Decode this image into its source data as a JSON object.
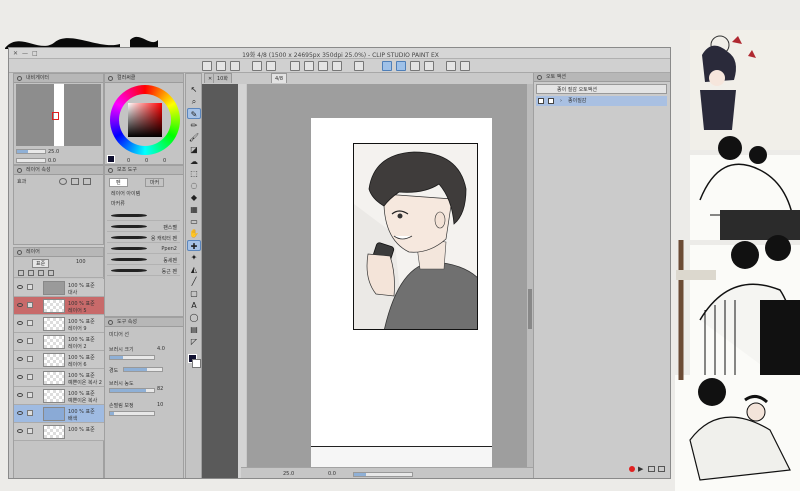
{
  "window": {
    "title": "19화 4/8 (1500 x 24695px 350dpi 25.0%) - CLIP STUDIO PAINT EX",
    "close_glyph": "✕",
    "minimize_glyph": "—",
    "maximize_glyph": "□"
  },
  "panels": {
    "navigator": {
      "title": "내비게이터",
      "zoom": "25.0",
      "angle": "0.0"
    },
    "color_wheel": {
      "title": "컬러써클",
      "h": "0",
      "s": "0",
      "v": "0"
    },
    "layer_property": {
      "title": "레이어 속성",
      "effect_label": "효과"
    },
    "sub_tool": {
      "title": "보조 도구",
      "tabs": [
        "펜",
        "마커"
      ],
      "first_item": "레이어 아이템",
      "group_label": "마커류",
      "brushes": [
        {
          "label": ""
        },
        {
          "label": "팬스펠"
        },
        {
          "label": "용 캐릭터 펜"
        },
        {
          "label": "Ppen2"
        },
        {
          "label": "동세펜"
        },
        {
          "label": "동근 펜"
        }
      ]
    },
    "tool_property": {
      "title": "도구 속성",
      "tool_name": "미디어 선",
      "brush_size_label": "브러시 크기",
      "brush_size": "4.0",
      "hardness_label": "경도",
      "density_label": "브러시 농도",
      "density": "82",
      "stabilization_label": "손떨림 보정",
      "stabilization": "10"
    },
    "layer": {
      "title": "레이어",
      "blend_mode": "표준",
      "opacity": "100",
      "rows": [
        {
          "line1": "100 % 표준",
          "line2": "대사",
          "selected": false
        },
        {
          "line1": "100 % 표준",
          "line2": "레이어 5",
          "selected": false
        },
        {
          "line1": "100 % 표준",
          "line2": "레이어 9",
          "selected": false
        },
        {
          "line1": "100 % 표준",
          "line2": "레이어 2",
          "selected": false
        },
        {
          "line1": "100 % 표준",
          "line2": "레이어 6",
          "selected": false
        },
        {
          "line1": "100 % 표준",
          "line2": "예쁜이온 복사 2",
          "selected": false
        },
        {
          "line1": "100 % 표준",
          "line2": "예쁜이온 복사",
          "selected": false
        },
        {
          "line1": "100 % 표준",
          "line2": "배색",
          "selected": true
        },
        {
          "line1": "100 % 표준",
          "line2": "",
          "selected": false
        }
      ]
    },
    "auto_action": {
      "title": "오토 액션",
      "set_name": "종이 질감 오토액션",
      "action_name": "종이질감"
    }
  },
  "document_tabs": [
    "10화",
    "4/8"
  ],
  "status": {
    "zoom": "25.0",
    "angle": "0.0"
  },
  "colors": {
    "accent": "#4f7fb8",
    "layer_selected": "#9fbbe2",
    "record": "#e02020",
    "fg_color": "#101030"
  }
}
